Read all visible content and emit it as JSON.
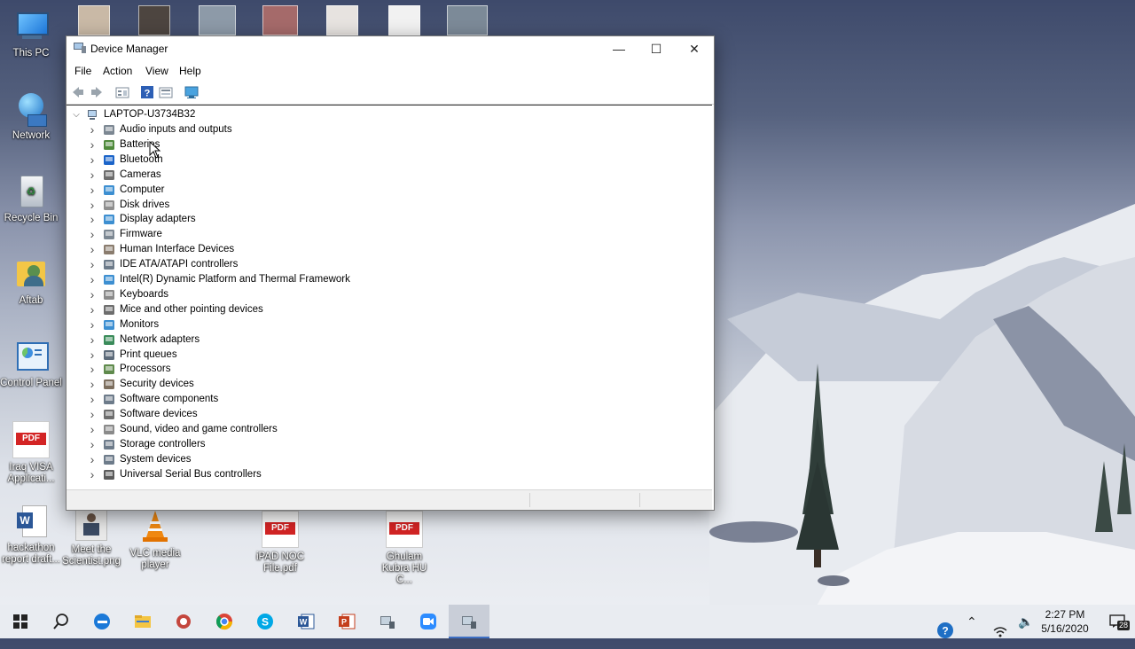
{
  "desktop": {
    "icons": [
      {
        "label": "This PC"
      },
      {
        "label": "Network"
      },
      {
        "label": "Recycle Bin"
      },
      {
        "label": "Aftab"
      },
      {
        "label": "Control Panel"
      },
      {
        "label": "Iraq VISA Applicati..."
      },
      {
        "label": "hackathon report draft..."
      },
      {
        "label": "Meet the Scientist.png"
      },
      {
        "label": "VLC media player"
      },
      {
        "label": "iPAD NOC File.pdf"
      },
      {
        "label": "Ghulam Kubra HU C..."
      }
    ],
    "pdf_badge": "PDF"
  },
  "window": {
    "title": "Device Manager",
    "controls": {
      "minimize": "—",
      "maximize": "☐",
      "close": "✕"
    },
    "menu": [
      "File",
      "Action",
      "View",
      "Help"
    ],
    "tree": {
      "root": "LAPTOP-U3734B32",
      "items": [
        "Audio inputs and outputs",
        "Batteries",
        "Bluetooth",
        "Cameras",
        "Computer",
        "Disk drives",
        "Display adapters",
        "Firmware",
        "Human Interface Devices",
        "IDE ATA/ATAPI controllers",
        "Intel(R) Dynamic Platform and Thermal Framework",
        "Keyboards",
        "Mice and other pointing devices",
        "Monitors",
        "Network adapters",
        "Print queues",
        "Processors",
        "Security devices",
        "Software components",
        "Software devices",
        "Sound, video and game controllers",
        "Storage controllers",
        "System devices",
        "Universal Serial Bus controllers"
      ]
    }
  },
  "taskbar": {
    "time": "2:27 PM",
    "date": "5/16/2020",
    "notification_count": "28",
    "apps": [
      "start-icon",
      "search-icon",
      "edge-icon",
      "file-explorer-icon",
      "snipping-icon",
      "chrome-icon",
      "skype-icon",
      "word-icon",
      "powerpoint-icon",
      "network-tool-icon",
      "zoom-icon",
      "device-manager-icon"
    ]
  },
  "colors": {
    "accent": "#3d6fc4",
    "pdf_red": "#d32424",
    "sky_top": "#3e4a6b",
    "snow": "#eef0f4"
  }
}
